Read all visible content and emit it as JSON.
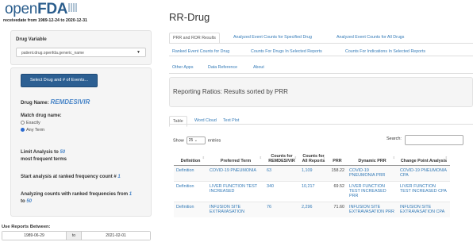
{
  "sidebar": {
    "logo_prefix": "open",
    "logo_bold": "FDA",
    "received": "receivedate from 1989-12-24 to 2020-12-31",
    "drug_variable_label": "Drug Variable",
    "drug_variable_value": "patient.drug.openfda.generic_name",
    "select_button": "Select Drug and # of Events...",
    "drug_name_label": "Drug Name:",
    "drug_name_value": "REMDESIVIR",
    "match_label": "Match drug name:",
    "match_options": [
      "Exactly",
      "Any Term"
    ],
    "limit_pre": "Limit Analysis to",
    "limit_val": "50",
    "limit_post": "most frequent terms",
    "start_text": "Start analysis at ranked frequency count #",
    "start_val": "1",
    "analyzing_text": "Analyzing counts with ranked frequencies from",
    "analyzing_from": "1",
    "analyzing_to_word": "to",
    "analyzing_to": "50",
    "use_between": "Use Reports Between:",
    "date_from": "1989-06-29",
    "date_to_word": "to",
    "date_to": "2021-02-01"
  },
  "main": {
    "title": "RR-Drug",
    "tabs_row1": [
      "PRR and ROR Results",
      "Analyzed Event Counts for Specified Drug",
      "Analyzed Event Counts for All Drugs"
    ],
    "tabs_row2": [
      "Ranked Event Counts for Drug",
      "Counts For Drugs In Selected Reports",
      "Counts For Indications In Selected Reports"
    ],
    "tabs_row3": [
      "Other Apps",
      "Data Reference",
      "About"
    ],
    "panel_text": "Reporting Ratios: Results sorted by PRR",
    "subtabs": [
      "Table",
      "Word Cloud",
      "Text Plot"
    ],
    "show_label": "Show",
    "show_value": "25",
    "entries_label": "entries",
    "search_label": "Search:",
    "columns": [
      "Definition",
      "Preferred Term",
      "Counts for REMDESIVIR",
      "Counts for All Reports",
      "PRR",
      "Dynamic PRR",
      "Change Point Analysis"
    ],
    "rows": [
      {
        "def": "Definition",
        "term": "COVID-19 PNEUMONIA",
        "c1": "63",
        "c2": "1,109",
        "prr": "158.22",
        "dyn": "COVID-19 PNEUMONIA PRR",
        "cpa": "COVID-19 PNEUMONIA CPA"
      },
      {
        "def": "Definition",
        "term": "LIVER FUNCTION TEST INCREASED",
        "c1": "340",
        "c2": "10,217",
        "prr": "69.52",
        "dyn": "LIVER FUNCTION TEST INCREASED PRR",
        "cpa": "LIVER FUNCTION TEST INCREASED CPA"
      },
      {
        "def": "Definition",
        "term": "INFUSION SITE EXTRAVASATION",
        "c1": "76",
        "c2": "2,296",
        "prr": "71.60",
        "dyn": "INFUSION SITE EXTRAVASATION PRR",
        "cpa": "INFUSION SITE EXTRAVASATION CPA"
      }
    ]
  }
}
